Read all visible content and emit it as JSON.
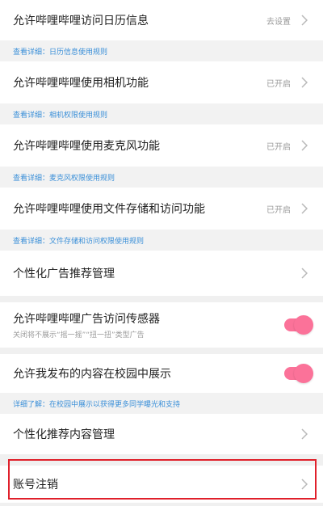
{
  "settings": {
    "calendar": {
      "title": "允许哔哩哔哩访问日历信息",
      "status": "去设置",
      "detail": "查看详细：日历信息使用规则"
    },
    "camera": {
      "title": "允许哔哩哔哩使用相机功能",
      "status": "已开启",
      "detail": "查看详细：相机权限使用规则"
    },
    "microphone": {
      "title": "允许哔哩哔哩使用麦克风功能",
      "status": "已开启",
      "detail": "查看详细：麦克风权限使用规则"
    },
    "storage": {
      "title": "允许哔哩哔哩使用文件存储和访问功能",
      "status": "已开启",
      "detail": "查看详细：文件存储和访问权限使用规则"
    },
    "ad_recommend": {
      "title": "个性化广告推荐管理"
    },
    "ad_sensor": {
      "title": "允许哔哩哔哩广告访问传感器",
      "subtitle": "关闭将不展示“摇一摇”“扭一扭”类型广告",
      "enabled": true
    },
    "campus": {
      "title": "允许我发布的内容在校园中展示",
      "detail": "详细了解：在校园中展示以获得更多同学曝光和支持",
      "enabled": true
    },
    "content_recommend": {
      "title": "个性化推荐内容管理"
    },
    "account_cancel": {
      "title": "账号注销"
    }
  },
  "icons": {
    "chevron": "chevron-right-icon"
  },
  "colors": {
    "accent": "#fb7299",
    "link": "#3a8fd8",
    "highlight_border": "#e0202b"
  }
}
